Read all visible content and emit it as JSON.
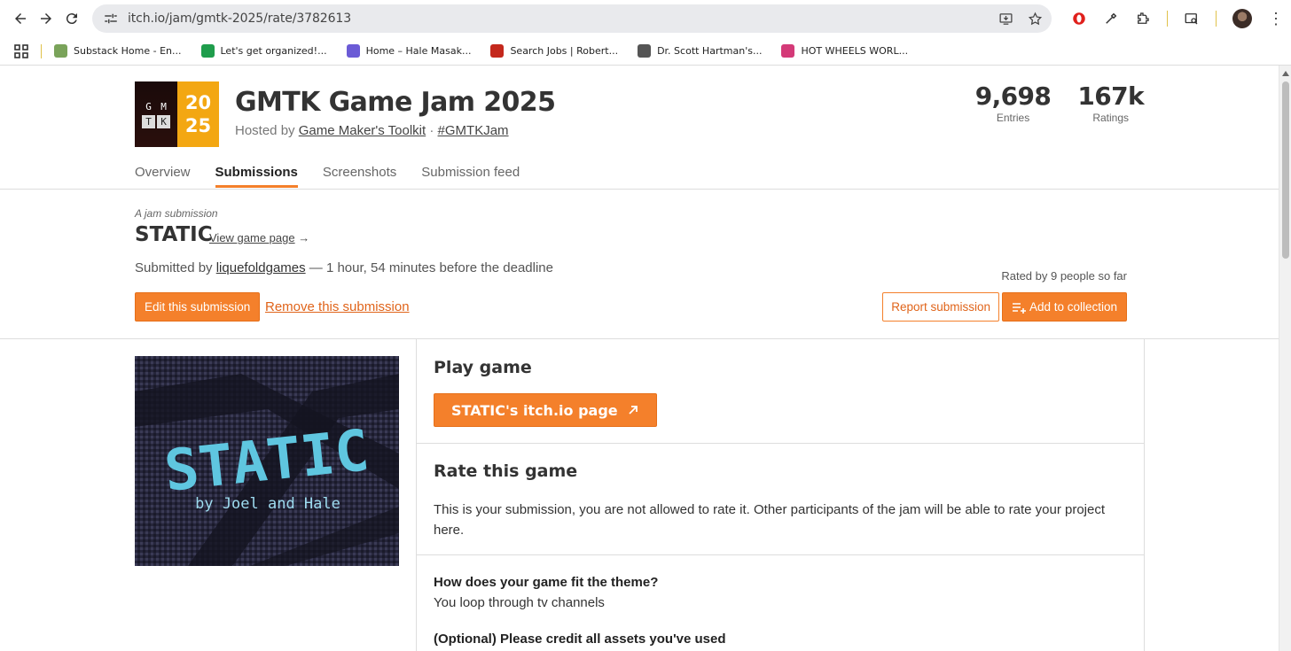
{
  "browser": {
    "url": "itch.io/jam/gmtk-2025/rate/3782613",
    "bookmarks": [
      {
        "label": "Substack Home - En...",
        "color": "#7aa35a"
      },
      {
        "label": "Let's get organized!...",
        "color": "#1f9d4c"
      },
      {
        "label": "Home – Hale Masak...",
        "color": "#6b5bd6"
      },
      {
        "label": "Search Jobs | Robert...",
        "color": "#c4281c"
      },
      {
        "label": "Dr. Scott Hartman's...",
        "color": "#555555"
      },
      {
        "label": "HOT WHEELS WORL...",
        "color": "#d43a78"
      }
    ]
  },
  "jam": {
    "logo_letters": [
      "G",
      "M",
      "T",
      "K"
    ],
    "logo_year_top": "20",
    "logo_year_bottom": "25",
    "title": "GMTK Game Jam 2025",
    "hosted_prefix": "Hosted by ",
    "host": "Game Maker's Toolkit",
    "hosted_sep": " · ",
    "hashtag": "#GMTKJam",
    "stats": {
      "entries_value": "9,698",
      "entries_label": "Entries",
      "ratings_value": "167k",
      "ratings_label": "Ratings"
    },
    "tabs": [
      "Overview",
      "Submissions",
      "Screenshots",
      "Submission feed"
    ],
    "active_tab": "Submissions"
  },
  "submission": {
    "kicker": "A jam submission",
    "title": "STATIC",
    "view_link": "View game page",
    "view_arrow": "→",
    "submitted_prefix": "Submitted by ",
    "submitter": "liquefoldgames",
    "submitted_suffix": " — 1 hour, 54 minutes before the deadline",
    "rated": "Rated by 9 people so far",
    "edit_label": "Edit this submission",
    "remove_label": "Remove this submission",
    "report_label": "Report submission",
    "collection_label": "Add to collection"
  },
  "cover": {
    "logo_text": "STATIC",
    "byline": "by Joel and Hale",
    "text_color": "#5fc6e0"
  },
  "play": {
    "heading": "Play game",
    "button": "STATIC's itch.io page"
  },
  "rate": {
    "heading": "Rate this game",
    "text": "This is your submission, you are not allowed to rate it. Other participants of the jam will be able to rate your project here."
  },
  "questions": [
    {
      "q": "How does your game fit the theme?",
      "a": "You loop through tv channels"
    },
    {
      "q": "(Optional) Please credit all assets you've used",
      "a": ""
    }
  ],
  "colors": {
    "accent": "#f4802b",
    "link_accent": "#e0641a"
  }
}
